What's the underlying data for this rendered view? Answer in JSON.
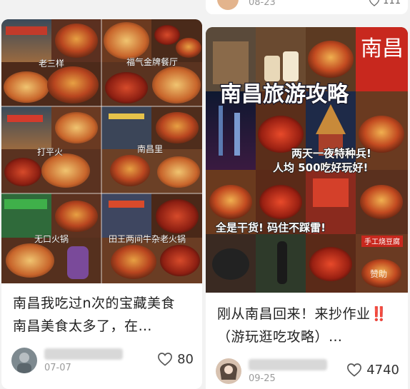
{
  "feed": {
    "top_partial": {
      "date": "08-23",
      "likes": "111"
    },
    "cards": [
      {
        "cover": {
          "labels": [
            "老三样",
            "福气金牌餐厅",
            "打平火",
            "南昌里",
            "无口火锅",
            "田王两间牛杂老火锅"
          ]
        },
        "title": "南昌我吃过n次的宝藏美食 南昌美食太多了，在…",
        "date": "07-07",
        "likes": "80",
        "icons": [
          "heart-icon"
        ]
      },
      {
        "cover": {
          "headline": "南昌旅游攻略",
          "corner_text": "南昌",
          "sub1": "两天一夜特种兵!",
          "sub2": "人均  500吃好玩好!",
          "sub3": "全是干货! 码住不踩雷!",
          "watermark": "赞助",
          "sign": "手工烧豆腐"
        },
        "title": "刚从南昌回来！来抄作业‼️（游玩逛吃攻略）…",
        "date": "09-25",
        "likes": "4740",
        "icons": [
          "heart-icon"
        ]
      }
    ]
  },
  "colors": {
    "page_bg": "#f2f2f2",
    "card_bg": "#ffffff",
    "title_text": "#222222",
    "meta_text": "#9a9a9a",
    "food_red": "#b8331f",
    "food_orange": "#d9782a",
    "headline_white": "#ffffff"
  }
}
